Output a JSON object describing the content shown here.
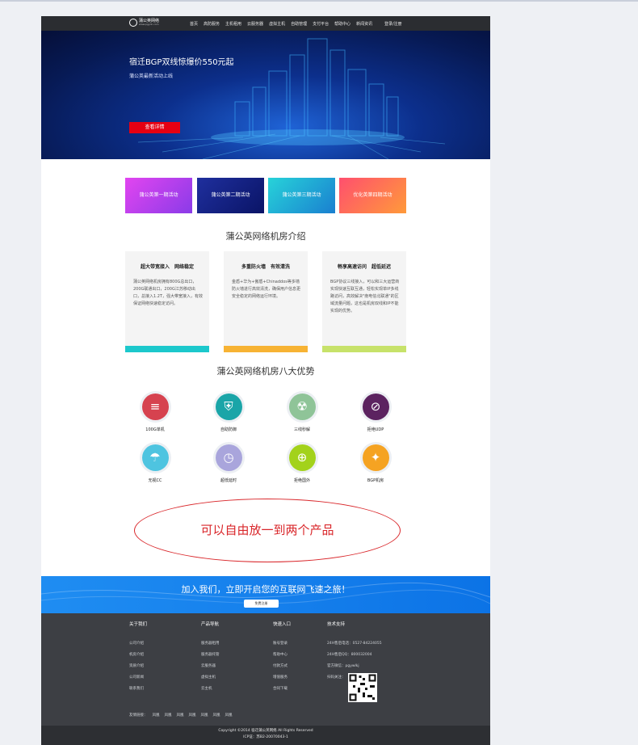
{
  "header": {
    "logo_name": "蒲公英网络",
    "logo_url": "www.pgydc.com",
    "nav": [
      "首页",
      "高防服务",
      "主机租用",
      "云服务器",
      "虚拟主机",
      "自助管理",
      "支付平台",
      "帮助中心",
      "新闻资讯"
    ],
    "login": "登录/注册"
  },
  "banner": {
    "title": "宿迁BGP双线惊爆价550元起",
    "subtitle": "蒲公英最新活动上线",
    "button": "查看详情"
  },
  "promos": [
    "蒲公英第一期活动",
    "蒲公英第二期活动",
    "蒲公英第三期活动",
    "优化英第四期活动"
  ],
  "intro": {
    "title": "蒲公英网络机房介绍",
    "cards": [
      {
        "title": "超大带宽接入　网络稳定",
        "text": "蒲公英网络机房拥有800G总出口，200G联通出口，200G江苏移动出口，总接入1.2T，强大带宽接入，有效保证网络快速稳定访问。"
      },
      {
        "title": "多重防火墙　有效清洗",
        "text": "金盾+华为+傲盾+Chinaddos等多墙防火墙进行高效清洗，确保用户信息更安全稳定的网络运行环境。"
      },
      {
        "title": "畅享高速访问　超低延迟",
        "text": "BGP协议三线接入，可以和三大运营商实现快速互联互通，轻松实现单IP多线路访问，高效解决\"南电信北联通\"的区域流量问题，这也是机房双线和IP不能实现的优势。"
      }
    ],
    "bar_colors": [
      "#1cc8cc",
      "#f7b334",
      "#c7e26a"
    ]
  },
  "advantages": {
    "title": "蒲公英网络机房八大优势",
    "items": [
      {
        "label": "100G单机",
        "icon": "server-icon",
        "color": "#d6424f",
        "glyph": "≡"
      },
      {
        "label": "自助防御",
        "icon": "shield-icon",
        "color": "#1aa5a8",
        "glyph": "⛨"
      },
      {
        "label": "三线秒解",
        "icon": "radiation-icon",
        "color": "#8fc498",
        "glyph": "☢"
      },
      {
        "label": "拒绝UDP",
        "icon": "ban-icon",
        "color": "#5c2360",
        "glyph": "⊘"
      },
      {
        "label": "无视CC",
        "icon": "umbrella-icon",
        "color": "#4ec4e0",
        "glyph": "☂"
      },
      {
        "label": "超低延时",
        "icon": "clock-icon",
        "color": "#a9a5dc",
        "glyph": "◷"
      },
      {
        "label": "拒绝国外",
        "icon": "globe-icon",
        "color": "#a3d21b",
        "glyph": "⊕"
      },
      {
        "label": "BGP机房",
        "icon": "bgp-icon",
        "color": "#f5a322",
        "glyph": "✦"
      }
    ]
  },
  "product_note": "可以自由放一到两个产品",
  "join": {
    "text": "加入我们，立即开启您的互联网飞速之旅！",
    "button": "免费注册"
  },
  "footer": {
    "columns": [
      {
        "head": "关于我们",
        "items": [
          "公司介绍",
          "机房介绍",
          "资质介绍",
          "公司新闻",
          "联系我们"
        ]
      },
      {
        "head": "产品导航",
        "items": [
          "服务器租用",
          "服务器托管",
          "云服务器",
          "虚拟主机",
          "云主机"
        ]
      },
      {
        "head": "快速入口",
        "items": [
          "账号登录",
          "帮助中心",
          "付款方式",
          "增值服务",
          "合同下载"
        ]
      },
      {
        "head": "技术支持",
        "items": [
          "24H售后电话：0527-84224055",
          "24H售后QQ：800032004",
          "官方微信：pgywlkj",
          "扫码关注："
        ]
      }
    ],
    "friend_label": "友情链接：",
    "friend_links": [
      "凤凰",
      "凤凰",
      "凤凰",
      "凤凰",
      "凤凰",
      "凤凰",
      "凤凰"
    ],
    "copyright": "Copyright ©2014 宿迁蒲公英网络 All Rights Reserved",
    "icp": "ICP证：苏B2-20070043-1"
  }
}
